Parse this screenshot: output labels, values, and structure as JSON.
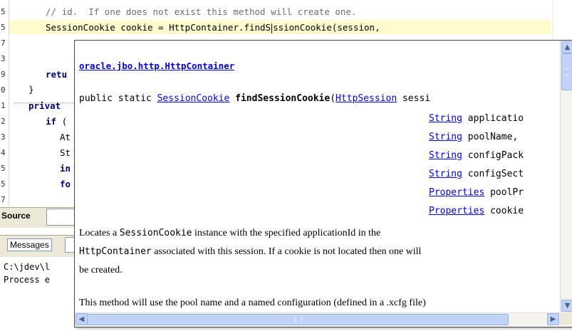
{
  "editor": {
    "line_numbers": [
      "5",
      "5",
      "7",
      "3",
      "9",
      "0",
      "1",
      "2",
      "3",
      "4",
      "5",
      "5",
      "7"
    ],
    "line1_comment": "// id.  If one does not exist this method will create one.",
    "line2_pre": "SessionCookie cookie = HttpContainer.findS",
    "line2_post": "ssionCookie(session,",
    "line5_kw": "retu",
    "line6": "}",
    "line7_kw": "privat",
    "line8_kw": "if",
    "line8_rest": " (",
    "line9": "At",
    "line10": "St",
    "line11_kw": "in",
    "line12_kw": "fo"
  },
  "tabs": {
    "source_label": "Source",
    "messages_label": "Messages"
  },
  "log": {
    "line1": "C:\\jdev\\l",
    "line2": "Process e"
  },
  "popup": {
    "package_link": "oracle.jbo.http.HttpContainer",
    "sig_prefix": "public static ",
    "sig_return_type": "SessionCookie",
    "sig_method": "findSessionCookie",
    "sig_paren": "(",
    "params": [
      {
        "type": "HttpSession",
        "name": " sessi"
      },
      {
        "type": "String",
        "name": " applicatio"
      },
      {
        "type": "String",
        "name": " poolName,"
      },
      {
        "type": "String",
        "name": " configPack"
      },
      {
        "type": "String",
        "name": " configSect"
      },
      {
        "type": "Properties",
        "name": " poolPr"
      },
      {
        "type": "Properties",
        "name": " cookie"
      }
    ],
    "desc1_a": "Locates a ",
    "desc1_code": "SessionCookie",
    "desc1_b": " instance with the specified applicationId in the",
    "desc2_code": "HttpContainer",
    "desc2_b": " associated with this session.  If a cookie is not located then one will",
    "desc3": "be created.",
    "desc4": "This method will use the pool name and a named configuration (defined in a .xcfg file)"
  },
  "scrollbars": {
    "up_arrow": "▲",
    "down_arrow": "▼",
    "left_arrow": "◀",
    "right_arrow": "▶"
  },
  "colors": {
    "current_line": "#fffbcc",
    "link": "#0000ee",
    "keyword": "#000080"
  }
}
